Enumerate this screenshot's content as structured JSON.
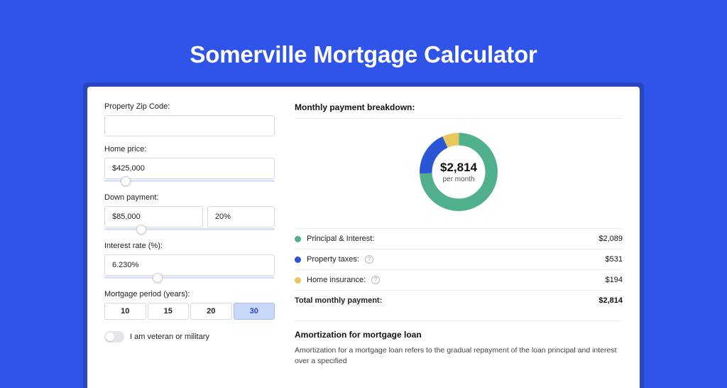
{
  "page": {
    "title": "Somerville Mortgage Calculator"
  },
  "form": {
    "zip_label": "Property Zip Code:",
    "zip_value": "",
    "price_label": "Home price:",
    "price_value": "$425,000",
    "down_label": "Down payment:",
    "down_value": "$85,000",
    "down_pct": "20%",
    "rate_label": "Interest rate (%):",
    "rate_value": "6.230%",
    "period_label": "Mortgage period (years):",
    "periods": [
      "10",
      "15",
      "20",
      "30"
    ],
    "period_selected": "30",
    "veteran_label": "I am veteran or military"
  },
  "breakdown": {
    "title": "Monthly payment breakdown:",
    "total": "$2,814",
    "total_sub": "per month",
    "items": [
      {
        "label": "Principal & Interest:",
        "value": "$2,089",
        "color": "#4fb08b",
        "info": false
      },
      {
        "label": "Property taxes:",
        "value": "$531",
        "color": "#2a55d6",
        "info": true
      },
      {
        "label": "Home insurance:",
        "value": "$194",
        "color": "#e9c85b",
        "info": true
      }
    ],
    "total_row": {
      "label": "Total monthly payment:",
      "value": "$2,814"
    }
  },
  "amort": {
    "heading": "Amortization for mortgage loan",
    "body": "Amortization for a mortgage loan refers to the gradual repayment of the loan principal and interest over a specified"
  },
  "chart_data": {
    "type": "pie",
    "title": "Monthly payment breakdown",
    "series": [
      {
        "name": "Principal & Interest",
        "value": 2089,
        "color": "#4fb08b"
      },
      {
        "name": "Property taxes",
        "value": 531,
        "color": "#2a55d6"
      },
      {
        "name": "Home insurance",
        "value": 194,
        "color": "#e9c85b"
      }
    ],
    "total": 2814,
    "unit": "$ per month"
  }
}
